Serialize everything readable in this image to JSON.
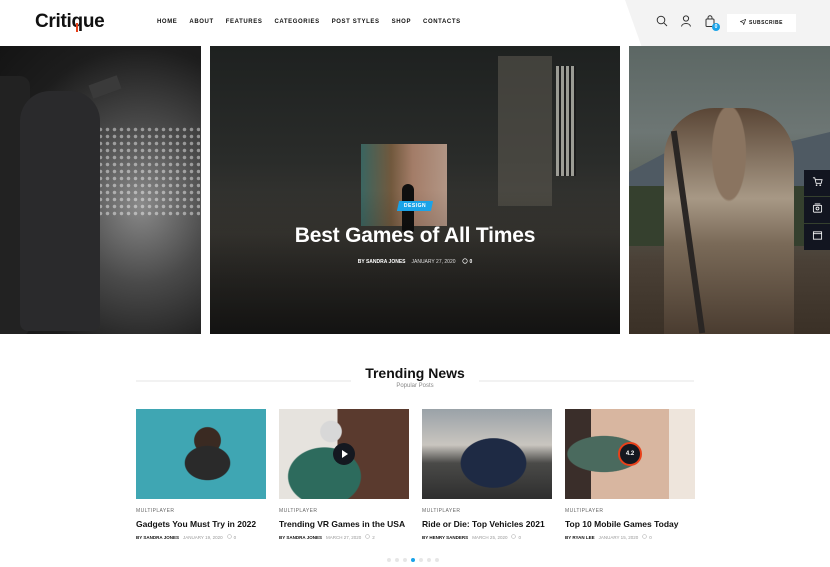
{
  "header": {
    "logo": "Critique",
    "nav": [
      "HOME",
      "ABOUT",
      "FEATURES",
      "CATEGORIES",
      "POST STYLES",
      "SHOP",
      "CONTACTS"
    ],
    "cart_count": "0",
    "subscribe_label": "SUBSCRIBE",
    "icons": [
      "search-icon",
      "user-icon",
      "shopping-bag-icon",
      "send-icon"
    ]
  },
  "hero": {
    "tag": "DESIGN",
    "title": "Best Games of All Times",
    "author": "BY SANDRA JONES",
    "date": "JANUARY 27, 2020",
    "comments": "0"
  },
  "side_panel": {
    "icons": [
      "cart-icon",
      "image-icon",
      "window-icon"
    ]
  },
  "trending": {
    "title": "Trending News",
    "subtitle": "Popular Posts",
    "cards": [
      {
        "category": "MULTIPLAYER",
        "title": "Gadgets You Must Try in 2022",
        "author": "BY SANDRA JONES",
        "date": "JANUARY 19, 2020",
        "comments": "0"
      },
      {
        "category": "MULTIPLAYER",
        "title": "Trending VR Games in the USA",
        "author": "BY SANDRA JONES",
        "date": "MARCH 27, 2020",
        "comments": "2"
      },
      {
        "category": "MULTIPLAYER",
        "title": "Ride or Die: Top Vehicles 2021",
        "author": "BY HENRY SANDERS",
        "date": "MARCH 25, 2020",
        "comments": "0"
      },
      {
        "category": "MULTIPLAYER",
        "title": "Top 10 Mobile Games Today",
        "author": "BY RYAN LEE",
        "date": "JANUARY 15, 2020",
        "comments": "0",
        "rating": "4.2"
      }
    ]
  },
  "pagination": {
    "total": 7,
    "active": 4
  },
  "colors": {
    "accent": "#1aa3e8",
    "logo_accent": "#e8411a",
    "dark": "#121520"
  }
}
